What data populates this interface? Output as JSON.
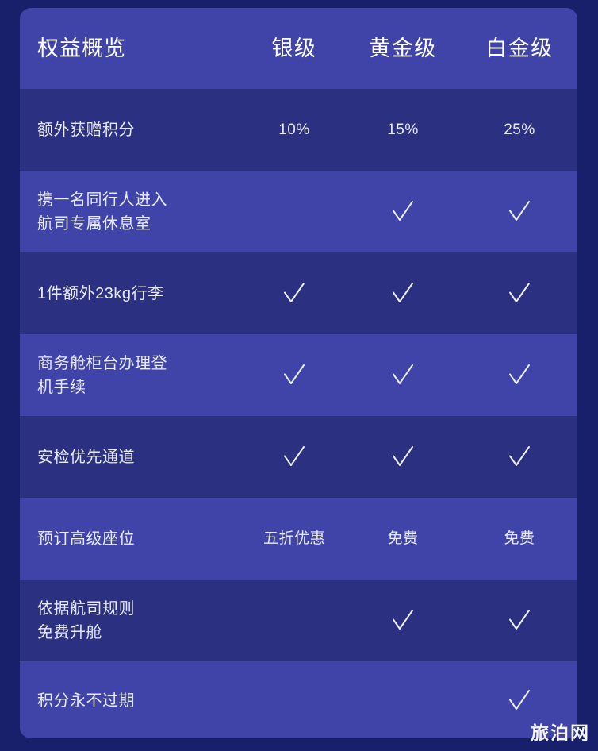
{
  "card": {
    "title": "权益概览",
    "tier_columns": [
      "银级",
      "黄金级",
      "白金级"
    ],
    "rows": [
      {
        "label": "额外获赠积分",
        "label_line1": "额外获赠积分",
        "label_line2": "",
        "values": [
          "10%",
          "15%",
          "25%"
        ],
        "types": [
          "text",
          "text",
          "text"
        ],
        "shade": "dark"
      },
      {
        "label": "携一名同行人进入航司专属休息室",
        "label_line1": "携一名同行人进入",
        "label_line2": "航司专属休息室",
        "values": [
          "",
          "check",
          "check"
        ],
        "types": [
          "empty",
          "check",
          "check"
        ],
        "shade": "light"
      },
      {
        "label": "1件额外23kg行李",
        "label_line1": "1件额外23kg行李",
        "label_line2": "",
        "values": [
          "check",
          "check",
          "check"
        ],
        "types": [
          "check",
          "check",
          "check"
        ],
        "shade": "dark"
      },
      {
        "label": "商务舱柜台办理登机手续",
        "label_line1": "商务舱柜台办理登",
        "label_line2": "机手续",
        "values": [
          "check",
          "check",
          "check"
        ],
        "types": [
          "check",
          "check",
          "check"
        ],
        "shade": "light"
      },
      {
        "label": "安检优先通道",
        "label_line1": "安检优先通道",
        "label_line2": "",
        "values": [
          "check",
          "check",
          "check"
        ],
        "types": [
          "check",
          "check",
          "check"
        ],
        "shade": "dark"
      },
      {
        "label": "预订高级座位",
        "label_line1": "预订高级座位",
        "label_line2": "",
        "values": [
          "五折优惠",
          "免费",
          "免费"
        ],
        "types": [
          "text",
          "text",
          "text"
        ],
        "shade": "light"
      },
      {
        "label": "依据航司规则免费升舱",
        "label_line1": "依据航司规则",
        "label_line2": "免费升舱",
        "values": [
          "",
          "check",
          "check"
        ],
        "types": [
          "empty",
          "check",
          "check"
        ],
        "shade": "dark"
      },
      {
        "label": "积分永不过期",
        "label_line1": "积分永不过期",
        "label_line2": "",
        "values": [
          "",
          "",
          "check"
        ],
        "types": [
          "empty",
          "empty",
          "check"
        ],
        "shade": "light"
      }
    ]
  },
  "watermark": {
    "text": "旅泊网"
  },
  "colors": {
    "page_background": "#181f6b",
    "row_light": "#4044a8",
    "row_dark": "#2b3080",
    "header_background": "#4044a8",
    "text": "#e9eaf8",
    "check": "#eceefb"
  }
}
